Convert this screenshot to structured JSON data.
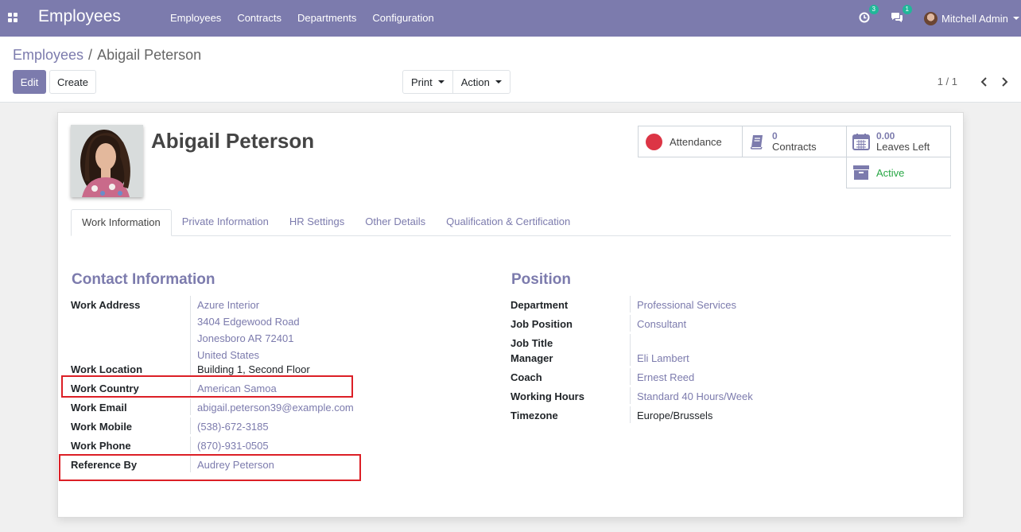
{
  "navbar": {
    "app_title": "Employees",
    "menu": [
      "Employees",
      "Contracts",
      "Departments",
      "Configuration"
    ],
    "activity_count": "3",
    "message_count": "1",
    "user_name": "Mitchell Admin"
  },
  "breadcrumb": {
    "parent": "Employees",
    "separator": "/",
    "current": "Abigail Peterson"
  },
  "buttons": {
    "edit": "Edit",
    "create": "Create",
    "print": "Print",
    "action": "Action"
  },
  "pager": {
    "value": "1 / 1"
  },
  "employee": {
    "name": "Abigail Peterson"
  },
  "smart_buttons": {
    "attendance": "Attendance",
    "contracts_value": "0",
    "contracts_label": "Contracts",
    "leaves_value": "0.00",
    "leaves_label": "Leaves Left",
    "active_label": "Active"
  },
  "tabs": [
    "Work Information",
    "Private Information",
    "HR Settings",
    "Other Details",
    "Qualification & Certification"
  ],
  "contact": {
    "title": "Contact Information",
    "work_address_label": "Work Address",
    "work_address_lines": [
      "Azure Interior",
      "3404 Edgewood Road",
      "Jonesboro AR 72401",
      "United States"
    ],
    "work_location_label": "Work Location",
    "work_location": "Building 1, Second Floor",
    "work_country_label": "Work Country",
    "work_country": "American Samoa",
    "work_email_label": "Work Email",
    "work_email": "abigail.peterson39@example.com",
    "work_mobile_label": "Work Mobile",
    "work_mobile": "(538)-672-3185",
    "work_phone_label": "Work Phone",
    "work_phone": "(870)-931-0505",
    "reference_label": "Reference By",
    "reference": "Audrey Peterson"
  },
  "position": {
    "title": "Position",
    "department_label": "Department",
    "department": "Professional Services",
    "job_position_label": "Job Position",
    "job_position": "Consultant",
    "job_title_label": "Job Title",
    "manager_label": "Manager",
    "manager": "Eli Lambert",
    "coach_label": "Coach",
    "coach": "Ernest Reed",
    "working_hours_label": "Working Hours",
    "working_hours": "Standard 40 Hours/Week",
    "timezone_label": "Timezone",
    "timezone": "Europe/Brussels"
  },
  "colors": {
    "brand": "#7c7bad",
    "highlight": "#dc1f26",
    "active": "#28a745",
    "attendance_dot": "#dc3545"
  }
}
